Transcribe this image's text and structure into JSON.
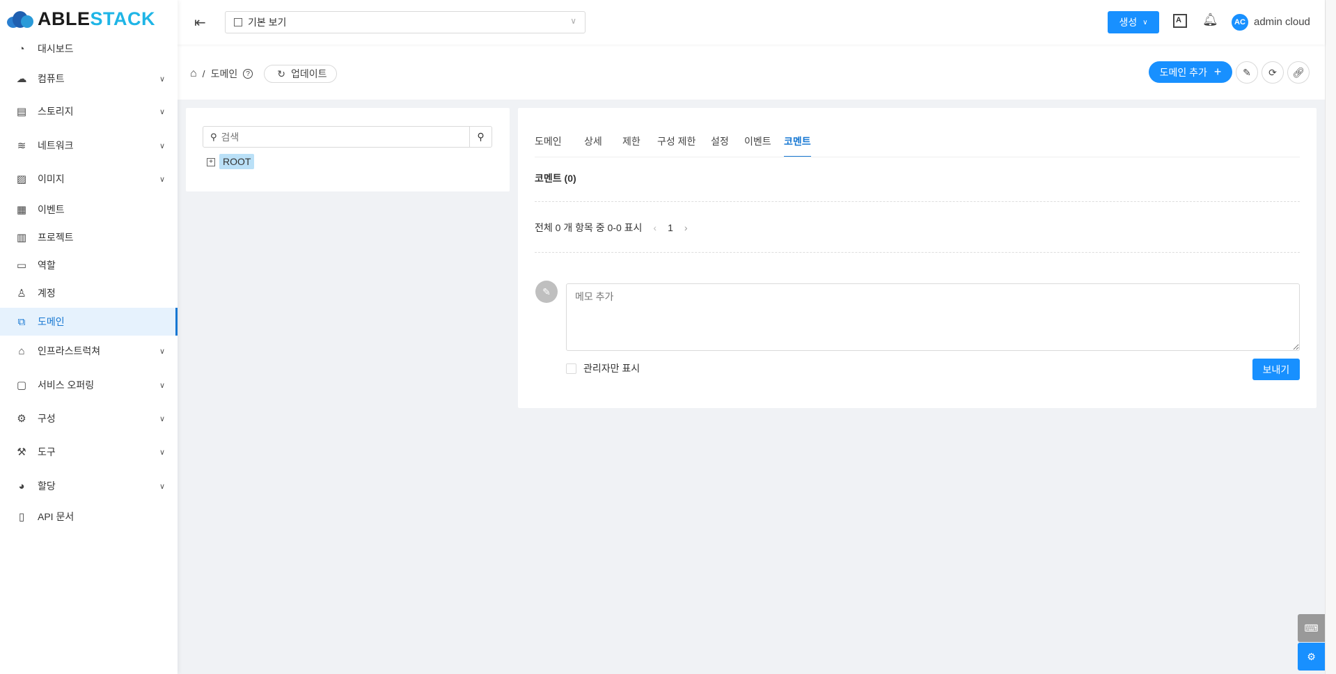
{
  "brand": {
    "logo_text_a": "ABLE",
    "logo_text_b": "STACK"
  },
  "header": {
    "view_select": "기본 보기",
    "create_label": "생성",
    "user_initials": "AC",
    "user_name": "admin cloud"
  },
  "sidebar": {
    "items": [
      {
        "label": "대시보드",
        "icon": "dashboard-icon",
        "chevron": false
      },
      {
        "label": "컴퓨트",
        "icon": "cloud-icon",
        "chevron": true
      },
      {
        "label": "스토리지",
        "icon": "storage-icon",
        "chevron": true
      },
      {
        "label": "네트워크",
        "icon": "wifi-icon",
        "chevron": true
      },
      {
        "label": "이미지",
        "icon": "image-icon",
        "chevron": true
      },
      {
        "label": "이벤트",
        "icon": "calendar-icon",
        "chevron": false
      },
      {
        "label": "프로젝트",
        "icon": "project-icon",
        "chevron": false
      },
      {
        "label": "역할",
        "icon": "idcard-icon",
        "chevron": false
      },
      {
        "label": "계정",
        "icon": "user-icon",
        "chevron": false
      },
      {
        "label": "도메인",
        "icon": "block-icon",
        "chevron": false,
        "active": true
      },
      {
        "label": "인프라스트럭쳐",
        "icon": "bank-icon",
        "chevron": true
      },
      {
        "label": "서비스 오퍼링",
        "icon": "shopping-icon",
        "chevron": true
      },
      {
        "label": "구성",
        "icon": "setting-icon",
        "chevron": true
      },
      {
        "label": "도구",
        "icon": "tool-icon",
        "chevron": true
      },
      {
        "label": "할당",
        "icon": "pie-chart-icon",
        "chevron": true
      },
      {
        "label": "API 문서",
        "icon": "read-icon",
        "chevron": false
      }
    ]
  },
  "breadcrumb": {
    "separator": "/",
    "current": "도메인",
    "refresh_label": "업데이트",
    "add_domain_label": "도메인 추가"
  },
  "tree": {
    "search_placeholder": "검색",
    "root_label": "ROOT"
  },
  "tabs": [
    "도메인",
    "상세",
    "제한",
    "구성 제한",
    "설정",
    "이벤트",
    "코멘트"
  ],
  "comments": {
    "title": "코멘트 (0)",
    "pagination_text": "전체 0 개 항목 중 0-0 표시",
    "page": "1",
    "memo_placeholder": "메모 추가",
    "admin_only_label": "관리자만 표시",
    "send_label": "보내기"
  }
}
